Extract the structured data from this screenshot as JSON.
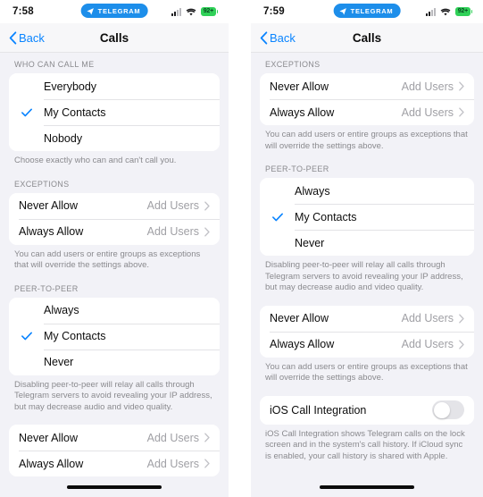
{
  "statusbar": {
    "time_left": "7:58",
    "time_right": "7:59",
    "app_pill_label": "TELEGRAM",
    "battery_label": "92+",
    "pill_color": "#1d8eea",
    "battery_color": "#30d158"
  },
  "nav": {
    "back_label": "Back",
    "title": "Calls",
    "tint_color": "#0a84ff"
  },
  "left_panel": {
    "sections": [
      {
        "header": "WHO CAN CALL ME",
        "rows": [
          {
            "label": "Everybody",
            "checked": false
          },
          {
            "label": "My Contacts",
            "checked": true
          },
          {
            "label": "Nobody",
            "checked": false
          }
        ],
        "footnote": "Choose exactly who can and can't call you."
      },
      {
        "header": "EXCEPTIONS",
        "rows": [
          {
            "label": "Never Allow",
            "value": "Add Users"
          },
          {
            "label": "Always Allow",
            "value": "Add Users"
          }
        ],
        "footnote": "You can add users or entire groups as exceptions that will override the settings above."
      },
      {
        "header": "PEER-TO-PEER",
        "rows": [
          {
            "label": "Always",
            "checked": false
          },
          {
            "label": "My Contacts",
            "checked": true
          },
          {
            "label": "Never",
            "checked": false
          }
        ],
        "footnote": "Disabling peer-to-peer will relay all calls through Telegram servers to avoid revealing your IP address, but may decrease audio and video quality."
      },
      {
        "header": "",
        "rows": [
          {
            "label": "Never Allow",
            "value": "Add Users"
          },
          {
            "label": "Always Allow",
            "value": "Add Users"
          }
        ],
        "footnote": ""
      }
    ]
  },
  "right_panel": {
    "sections": [
      {
        "header": "EXCEPTIONS",
        "rows": [
          {
            "label": "Never Allow",
            "value": "Add Users"
          },
          {
            "label": "Always Allow",
            "value": "Add Users"
          }
        ],
        "footnote": "You can add users or entire groups as exceptions that will override the settings above."
      },
      {
        "header": "PEER-TO-PEER",
        "rows": [
          {
            "label": "Always",
            "checked": false
          },
          {
            "label": "My Contacts",
            "checked": true
          },
          {
            "label": "Never",
            "checked": false
          }
        ],
        "footnote": "Disabling peer-to-peer will relay all calls through Telegram servers to avoid revealing your IP address, but may decrease audio and video quality."
      },
      {
        "header": "",
        "rows": [
          {
            "label": "Never Allow",
            "value": "Add Users"
          },
          {
            "label": "Always Allow",
            "value": "Add Users"
          }
        ],
        "footnote": "You can add users or entire groups as exceptions that will override the settings above."
      },
      {
        "header": "",
        "rows": [
          {
            "label": "iOS Call Integration",
            "toggle": true,
            "toggle_on": false
          }
        ],
        "footnote": "iOS Call Integration shows Telegram calls on the lock screen and in the system's call history. If iCloud sync is enabled, your call history is shared with Apple."
      }
    ]
  }
}
